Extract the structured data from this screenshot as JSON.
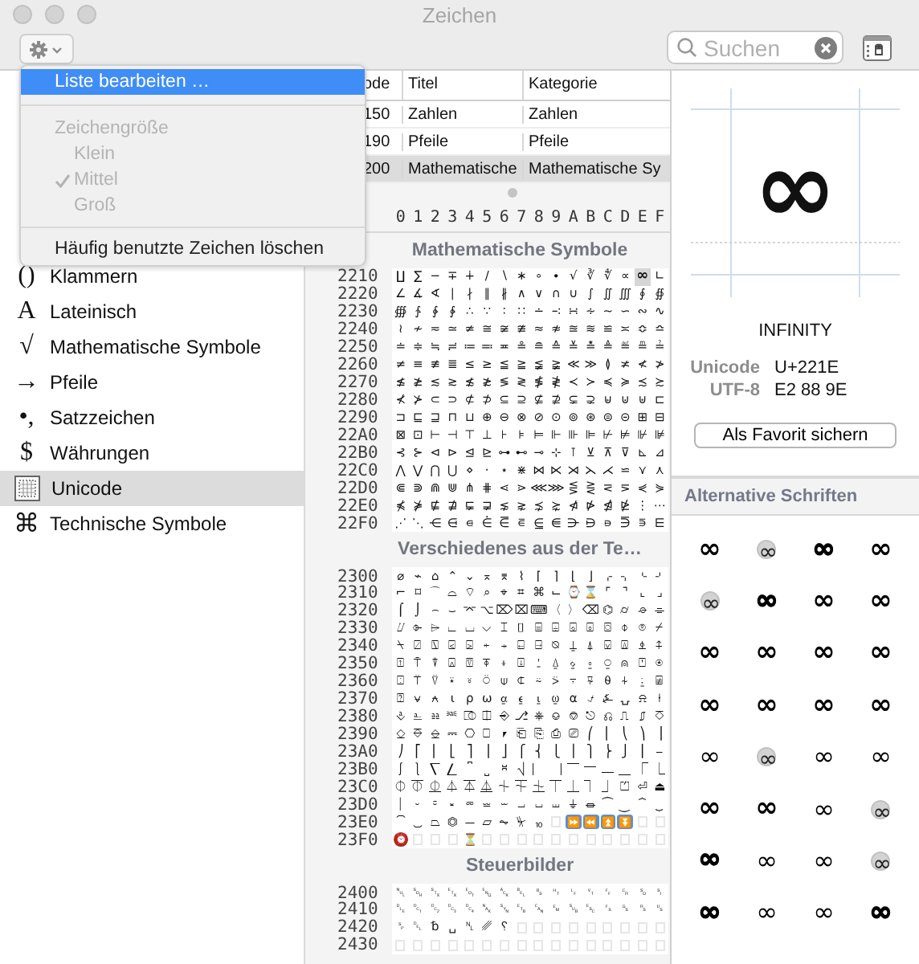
{
  "window": {
    "title": "Zeichen"
  },
  "search": {
    "placeholder": "Suchen"
  },
  "menu": [
    {
      "kind": "action",
      "label": "Liste bearbeiten …",
      "highlighted": true
    },
    {
      "kind": "separator"
    },
    {
      "kind": "header",
      "label": "Zeichengröße",
      "disabled": true
    },
    {
      "kind": "option",
      "label": "Klein",
      "checked": false,
      "disabled": true
    },
    {
      "kind": "option",
      "label": "Mittel",
      "checked": true,
      "disabled": true
    },
    {
      "kind": "option",
      "label": "Groß",
      "checked": false,
      "disabled": true
    },
    {
      "kind": "separator"
    },
    {
      "kind": "action",
      "label": "Häufig benutzte Zeichen löschen",
      "highlighted": false
    }
  ],
  "sidebar": {
    "items": [
      {
        "icon": "()",
        "label": "Klammern",
        "selected": false
      },
      {
        "icon": "A",
        "label": "Lateinisch",
        "selected": false
      },
      {
        "icon": "√",
        "label": "Mathematische Symbole",
        "selected": false
      },
      {
        "icon": "→",
        "label": "Pfeile",
        "selected": false
      },
      {
        "icon": "•,",
        "label": "Satzzeichen",
        "selected": false
      },
      {
        "icon": "$",
        "label": "Währungen",
        "selected": false
      },
      {
        "kind": "grid",
        "label": "Unicode",
        "selected": true
      },
      {
        "icon": "⌘",
        "label": "Technische Symbole",
        "selected": false
      }
    ]
  },
  "table": {
    "columns": [
      "ode",
      "Titel",
      "Kategorie"
    ],
    "rows": [
      {
        "cells": [
          "150",
          "Zahlen",
          "Zahlen"
        ],
        "selected": false
      },
      {
        "cells": [
          "190",
          "Pfeile",
          "Pfeile"
        ],
        "selected": false
      },
      {
        "cells": [
          "200",
          "Mathematische",
          "Mathematische Sy"
        ],
        "selected": true
      }
    ]
  },
  "hex_columns": [
    "0",
    "1",
    "2",
    "3",
    "4",
    "5",
    "6",
    "7",
    "8",
    "9",
    "A",
    "B",
    "C",
    "D",
    "E",
    "F"
  ],
  "sections": [
    {
      "title": "Mathematische Symbole",
      "rows": [
        {
          "label": "2210",
          "cells": [
            "∐",
            "∑",
            "−",
            "∓",
            "∔",
            "∕",
            "∖",
            "∗",
            "∘",
            "∙",
            "√",
            "∛",
            "∜",
            "∝",
            {
              "char": "∞",
              "selected": true
            },
            "∟"
          ]
        },
        {
          "label": "2220",
          "cells": [
            "∠",
            "∡",
            "∢",
            "∣",
            "∤",
            "∥",
            "∦",
            "∧",
            "∨",
            "∩",
            "∪",
            "∫",
            "∬",
            "∭",
            "∮",
            "∯"
          ]
        },
        {
          "label": "2230",
          "cells": [
            "∰",
            "∱",
            "∲",
            "∳",
            "∴",
            "∵",
            "∶",
            "∷",
            "∸",
            "∹",
            "∺",
            "∻",
            "∼",
            "∽",
            "∾",
            "∿"
          ]
        },
        {
          "label": "2240",
          "cells": [
            "≀",
            "≁",
            "≂",
            "≃",
            "≄",
            "≅",
            "≆",
            "≇",
            "≈",
            "≉",
            "≊",
            "≋",
            "≌",
            "≍",
            "≎",
            "≏"
          ]
        },
        {
          "label": "2250",
          "cells": [
            "≐",
            "≑",
            "≒",
            "≓",
            "≔",
            "≕",
            "≖",
            "≗",
            "≘",
            "≙",
            "≚",
            "≛",
            "≜",
            "≝",
            "≞",
            "≟"
          ]
        },
        {
          "label": "2260",
          "cells": [
            "≠",
            "≡",
            "≢",
            "≣",
            "≤",
            "≥",
            "≦",
            "≧",
            "≨",
            "≩",
            "≪",
            "≫",
            "≬",
            "≭",
            "≮",
            "≯"
          ]
        },
        {
          "label": "2270",
          "cells": [
            "≰",
            "≱",
            "≲",
            "≳",
            "≴",
            "≵",
            "≶",
            "≷",
            "≸",
            "≹",
            "≺",
            "≻",
            "≼",
            "≽",
            "≾",
            "≿"
          ]
        },
        {
          "label": "2280",
          "cells": [
            "⊀",
            "⊁",
            "⊂",
            "⊃",
            "⊄",
            "⊅",
            "⊆",
            "⊇",
            "⊈",
            "⊉",
            "⊊",
            "⊋",
            "⊌",
            "⊍",
            "⊎",
            "⊏"
          ]
        },
        {
          "label": "2290",
          "cells": [
            "⊐",
            "⊑",
            "⊒",
            "⊓",
            "⊔",
            "⊕",
            "⊖",
            "⊗",
            "⊘",
            "⊙",
            "⊚",
            "⊛",
            "⊜",
            "⊝",
            "⊞",
            "⊟"
          ]
        },
        {
          "label": "22A0",
          "cells": [
            "⊠",
            "⊡",
            "⊢",
            "⊣",
            "⊤",
            "⊥",
            "⊦",
            "⊧",
            "⊨",
            "⊩",
            "⊪",
            "⊫",
            "⊬",
            "⊭",
            "⊮",
            "⊯"
          ]
        },
        {
          "label": "22B0",
          "cells": [
            "⊰",
            "⊱",
            "⊲",
            "⊳",
            "⊴",
            "⊵",
            "⊶",
            "⊷",
            "⊸",
            "⊹",
            "⊺",
            "⊻",
            "⊼",
            "⊽",
            "⊾",
            "⊿"
          ]
        },
        {
          "label": "22C0",
          "cells": [
            "⋀",
            "⋁",
            "⋂",
            "⋃",
            "⋄",
            "⋅",
            "⋆",
            "⋇",
            "⋈",
            "⋉",
            "⋊",
            "⋋",
            "⋌",
            "⋍",
            "⋎",
            "⋏"
          ]
        },
        {
          "label": "22D0",
          "cells": [
            "⋐",
            "⋑",
            "⋒",
            "⋓",
            "⋔",
            "⋕",
            "⋖",
            "⋗",
            "⋘",
            "⋙",
            "⋚",
            "⋛",
            "⋜",
            "⋝",
            "⋞",
            "⋟"
          ]
        },
        {
          "label": "22E0",
          "cells": [
            "⋠",
            "⋡",
            "⋢",
            "⋣",
            "⋤",
            "⋥",
            "⋦",
            "⋧",
            "⋨",
            "⋩",
            "⋪",
            "⋫",
            "⋬",
            "⋭",
            "⋮",
            "⋯"
          ]
        },
        {
          "label": "22F0",
          "cells": [
            "⋰",
            "⋱",
            "⋲",
            "⋳",
            "⋴",
            "⋵",
            "⋶",
            "⋷",
            "⋸",
            "⋹",
            "⋺",
            "⋻",
            "⋼",
            "⋽",
            "⋾",
            "⋿"
          ]
        }
      ]
    },
    {
      "title": "Verschiedenes aus der Te…",
      "rows": [
        {
          "label": "2300",
          "cells": [
            "⌀",
            "⌁",
            "⌂",
            "⌃",
            "⌄",
            "⌅",
            "⌆",
            "⌇",
            "⌈",
            "⌉",
            "⌊",
            "⌋",
            "⌌",
            "⌍",
            "⌎",
            "⌏"
          ]
        },
        {
          "label": "2310",
          "cells": [
            "⌐",
            "⌑",
            "⌒",
            "⌓",
            "⌔",
            "⌕",
            "⌖",
            "⌗",
            "⌘",
            "⌙",
            "⌚",
            "⌛",
            "⌜",
            "⌝",
            "⌞",
            "⌟"
          ]
        },
        {
          "label": "2320",
          "cells": [
            "⌠",
            "⌡",
            "⌢",
            "⌣",
            "⌤",
            "⌥",
            "⌦",
            "⌧",
            "⌨",
            "〈",
            "〉",
            "⌫",
            "⌬",
            "⌭",
            "⌮",
            "⌯"
          ]
        },
        {
          "label": "2330",
          "cells": [
            "⌰",
            "⌱",
            "⌲",
            "⌳",
            "⌴",
            "⌵",
            "⌶",
            "⌷",
            "⌸",
            "⌹",
            "⌺",
            "⌻",
            "⌼",
            "⌽",
            "⌾",
            "⌿"
          ]
        },
        {
          "label": "2340",
          "cells": [
            "⍀",
            "⍁",
            "⍂",
            "⍃",
            "⍄",
            "⍅",
            "⍆",
            "⍇",
            "⍈",
            "⍉",
            "⍊",
            "⍋",
            "⍌",
            "⍍",
            "⍎",
            "⍏"
          ]
        },
        {
          "label": "2350",
          "cells": [
            "⍐",
            "⍑",
            "⍒",
            "⍓",
            "⍔",
            "⍕",
            "⍖",
            "⍗",
            "⍘",
            "⍙",
            "⍚",
            "⍛",
            "⍜",
            "⍝",
            "⍞",
            "⍟"
          ]
        },
        {
          "label": "2360",
          "cells": [
            "⍠",
            "⍡",
            "⍢",
            "⍣",
            "⍤",
            "⍥",
            "⍦",
            "⍧",
            "⍨",
            "⍩",
            "⍪",
            "⍫",
            "⍬",
            "⍭",
            "⍮",
            "⍯"
          ]
        },
        {
          "label": "2370",
          "cells": [
            "⍰",
            "⍱",
            "⍲",
            "⍳",
            "⍴",
            "⍵",
            "⍶",
            "⍷",
            "⍸",
            "⍹",
            "⍺",
            "⍻",
            "⍼",
            "⍽",
            "⍾",
            "⍿"
          ]
        },
        {
          "label": "2380",
          "cells": [
            "⎀",
            "⎁",
            "⎂",
            "⎃",
            "⎄",
            "⎅",
            "⎆",
            "⎇",
            "⎈",
            "⎉",
            "⎊",
            "⎋",
            "⎌",
            "⎍",
            "⎎",
            "⎏"
          ]
        },
        {
          "label": "2390",
          "cells": [
            "⎐",
            "⎑",
            "⎒",
            "⎓",
            "⎔",
            "⎕",
            "⎖",
            "⎗",
            "⎘",
            "⎙",
            "⎚",
            "⎛",
            "⎜",
            "⎝",
            "⎞",
            "⎟"
          ]
        },
        {
          "label": "23A0",
          "cells": [
            "⎠",
            "⎡",
            "⎢",
            "⎣",
            "⎤",
            "⎥",
            "⎦",
            "⎧",
            "⎨",
            "⎩",
            "⎪",
            "⎫",
            "⎬",
            "⎭",
            "⎮",
            "⎯"
          ]
        },
        {
          "label": "23B0",
          "cells": [
            "⎰",
            "⎱",
            "⎲",
            "⎳",
            "⎴",
            "⎵",
            "⎶",
            "⎷",
            "⎸",
            "⎹",
            "⎺",
            "⎻",
            "⎼",
            "⎽",
            "⎾",
            "⎿"
          ]
        },
        {
          "label": "23C0",
          "cells": [
            "⏀",
            "⏁",
            "⏂",
            "⏃",
            "⏄",
            "⏅",
            "⏆",
            "⏇",
            "⏈",
            "⏉",
            "⏊",
            "⏋",
            "⏌",
            "⏍",
            "⏎",
            "⏏"
          ]
        },
        {
          "label": "23D0",
          "cells": [
            "⏐",
            "⏑",
            "⏒",
            "⏓",
            "⏔",
            "⏕",
            "⏖",
            "⏗",
            "⏘",
            "⏙",
            "⏚",
            "⏛",
            "⏜",
            "⏝",
            "⏞",
            "⏟"
          ]
        },
        {
          "label": "23E0",
          "cells": [
            "⏠",
            "⏡",
            "⏢",
            "⏣",
            "⏤",
            "⏥",
            "⏦",
            "⏧",
            "⏨",
            null,
            {
              "char": "⏩",
              "kind": "button"
            },
            {
              "char": "⏪",
              "kind": "button"
            },
            {
              "char": "⏫",
              "kind": "button"
            },
            {
              "char": "⏬",
              "kind": "button"
            },
            null,
            null
          ]
        },
        {
          "label": "23F0",
          "cells": [
            {
              "char": "⏰",
              "kind": "badge"
            },
            null,
            null,
            null,
            "⏳",
            null,
            null,
            null,
            null,
            null,
            null,
            null,
            null,
            null,
            null,
            null
          ]
        }
      ]
    },
    {
      "title": "Steuerbilder",
      "rows": [
        {
          "label": "2400",
          "cells": [
            "␀",
            "␁",
            "␂",
            "␃",
            "␄",
            "␅",
            "␆",
            "␇",
            "␈",
            "␉",
            "␊",
            "␋",
            "␌",
            "␍",
            "␎",
            "␏"
          ]
        },
        {
          "label": "2410",
          "cells": [
            "␐",
            "␑",
            "␒",
            "␓",
            "␔",
            "␕",
            "␖",
            "␗",
            "␘",
            "␙",
            "␚",
            "␛",
            "␜",
            "␝",
            "␞",
            "␟"
          ]
        },
        {
          "label": "2420",
          "cells": [
            "␠",
            "␡",
            "␢",
            "␣",
            "␤",
            "␥",
            "␦",
            null,
            null,
            null,
            null,
            null,
            null,
            null,
            null,
            null
          ]
        },
        {
          "label": "2430",
          "cells": [
            null,
            null,
            null,
            null,
            null,
            null,
            null,
            null,
            null,
            null,
            null,
            null,
            null,
            null,
            null,
            null
          ]
        }
      ]
    }
  ],
  "detail": {
    "glyph": "∞",
    "name": "INFINITY",
    "info": [
      {
        "label": "Unicode",
        "value": "U+221E"
      },
      {
        "label": "UTF-8",
        "value": "E2 88 9E"
      }
    ],
    "button": "Als Favorit sichern"
  },
  "alternatives": {
    "title": "Alternative Schriften",
    "items": [
      {
        "glyph": "∞",
        "kind": "bold"
      },
      {
        "glyph": "∞",
        "kind": "light"
      },
      {
        "glyph": "∞",
        "kind": "heavy"
      },
      {
        "glyph": "∞",
        "kind": "bold"
      },
      {
        "glyph": "∞",
        "kind": "light"
      },
      {
        "glyph": "∞",
        "kind": "heavy"
      },
      {
        "glyph": "∞",
        "kind": "bold"
      },
      {
        "glyph": "∞",
        "kind": "bold"
      },
      {
        "glyph": "∞",
        "kind": "bold"
      },
      {
        "glyph": "∞",
        "kind": "bold"
      },
      {
        "glyph": "∞",
        "kind": "bold"
      },
      {
        "glyph": "∞",
        "kind": "bold"
      },
      {
        "glyph": "∞",
        "kind": "bold"
      },
      {
        "glyph": "∞",
        "kind": "bold"
      },
      {
        "glyph": "∞",
        "kind": "bold"
      },
      {
        "glyph": "∞",
        "kind": "bold"
      },
      {
        "glyph": "∞",
        "kind": "regular"
      },
      {
        "glyph": "∞",
        "kind": "light"
      },
      {
        "glyph": "∞",
        "kind": "regular"
      },
      {
        "glyph": "∞",
        "kind": "regular"
      },
      {
        "glyph": "∞",
        "kind": "bold"
      },
      {
        "glyph": "∞",
        "kind": "bold"
      },
      {
        "glyph": "∞",
        "kind": "regular"
      },
      {
        "glyph": "∞",
        "kind": "light"
      },
      {
        "glyph": "∞",
        "kind": "heavy"
      },
      {
        "glyph": "∞",
        "kind": "regular"
      },
      {
        "glyph": "∞",
        "kind": "regular"
      },
      {
        "glyph": "∞",
        "kind": "light"
      },
      {
        "glyph": "∞",
        "kind": "heavy"
      },
      {
        "glyph": "∞",
        "kind": "regular"
      },
      {
        "glyph": "∞",
        "kind": "regular"
      },
      {
        "glyph": "∞",
        "kind": "heavy"
      }
    ]
  }
}
